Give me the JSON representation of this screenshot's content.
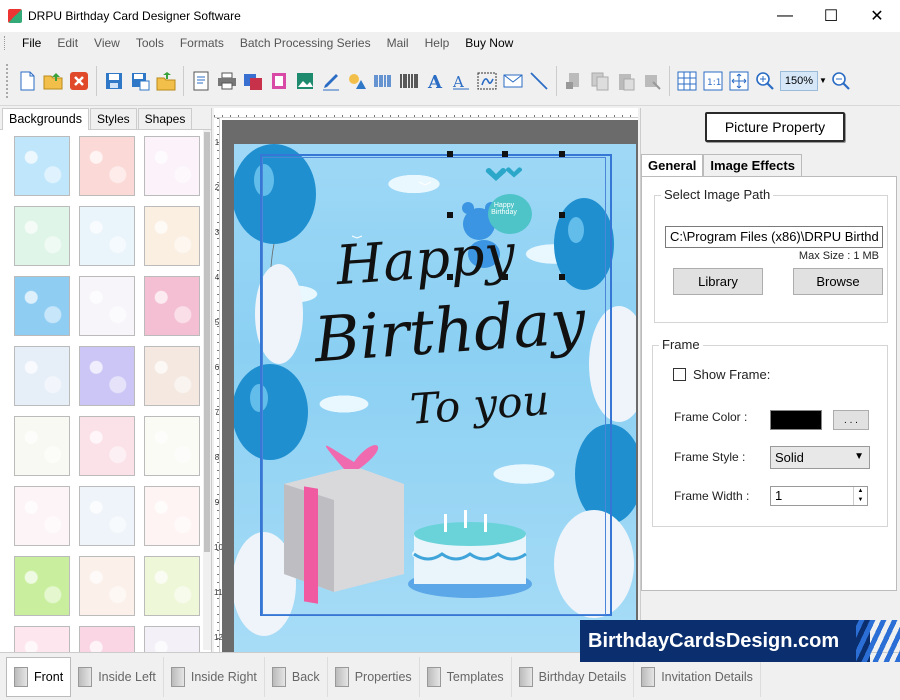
{
  "window": {
    "title": "DRPU Birthday Card Designer Software",
    "controls": {
      "minimize": "—",
      "maximize": "☐",
      "close": "✕"
    }
  },
  "menu": [
    "File",
    "Edit",
    "View",
    "Tools",
    "Formats",
    "Batch Processing Series",
    "Mail",
    "Help",
    "Buy Now"
  ],
  "toolbar": {
    "icons": [
      "new-icon",
      "open-icon",
      "close-file-icon",
      "save-icon",
      "save-as-icon",
      "export-icon",
      "properties-icon",
      "print-icon",
      "print-preview-icon",
      "copy-format-icon",
      "image-icon",
      "pen-icon",
      "shapes-icon",
      "barcode-icon",
      "barcode2-icon",
      "text-icon",
      "wordart-icon",
      "signature-icon",
      "email-icon",
      "line-icon",
      "cut-icon",
      "copy-icon",
      "paste-icon",
      "delete-icon",
      "grid-icon",
      "actual-size-icon",
      "fit-icon",
      "zoom-in-icon",
      "zoom-out-icon"
    ],
    "zoom_value": "150%"
  },
  "left_panel": {
    "tabs": [
      "Backgrounds",
      "Styles",
      "Shapes"
    ],
    "thumbnails": [
      "#bfe6fb",
      "#fbd9d6",
      "#fbf2fa",
      "#dff5e8",
      "#eaf4fb",
      "#fbefe2",
      "#8fcdf3",
      "#f7f5fa",
      "#f4bfd3",
      "#e6eef8",
      "#cbc6f5",
      "#f4e8e0",
      "#f9f9f3",
      "#fbe1e8",
      "#f9fbf4",
      "#fdf4f8",
      "#eef4f9",
      "#fff4f4",
      "#c9ef9e",
      "#fbf0ea",
      "#eff7d9",
      "#fde6ee",
      "#fad6e4",
      "#f3f0f8"
    ]
  },
  "card": {
    "line1": "Happy",
    "line2": "Birthday",
    "line3": "To you",
    "bear_badge": "Happy Birthday",
    "ruler_numbers": [
      "1",
      "2",
      "3",
      "4",
      "5",
      "6",
      "7",
      "8",
      "9",
      "10",
      "11",
      "12"
    ]
  },
  "right_panel": {
    "title_button": "Picture Property",
    "tabs": [
      "General",
      "Image Effects"
    ],
    "image_group": {
      "title": "Select Image Path",
      "path": "C:\\Program Files (x86)\\DRPU Birthd",
      "max_size": "Max Size : 1 MB",
      "library_button": "Library",
      "browse_button": "Browse"
    },
    "frame_group": {
      "title": "Frame",
      "show_frame_label": "Show Frame:",
      "frame_color_label": "Frame Color :",
      "frame_color_value": "#000000",
      "browse_color_button": ". . .",
      "frame_style_label": "Frame Style :",
      "frame_style_value": "Solid",
      "frame_width_label": "Frame Width :",
      "frame_width_value": "1"
    }
  },
  "bottom_tabs": [
    "Front",
    "Inside Left",
    "Inside Right",
    "Back",
    "Properties",
    "Templates",
    "Birthday Details",
    "Invitation Details"
  ],
  "watermark": "BirthdayCardsDesign.com"
}
